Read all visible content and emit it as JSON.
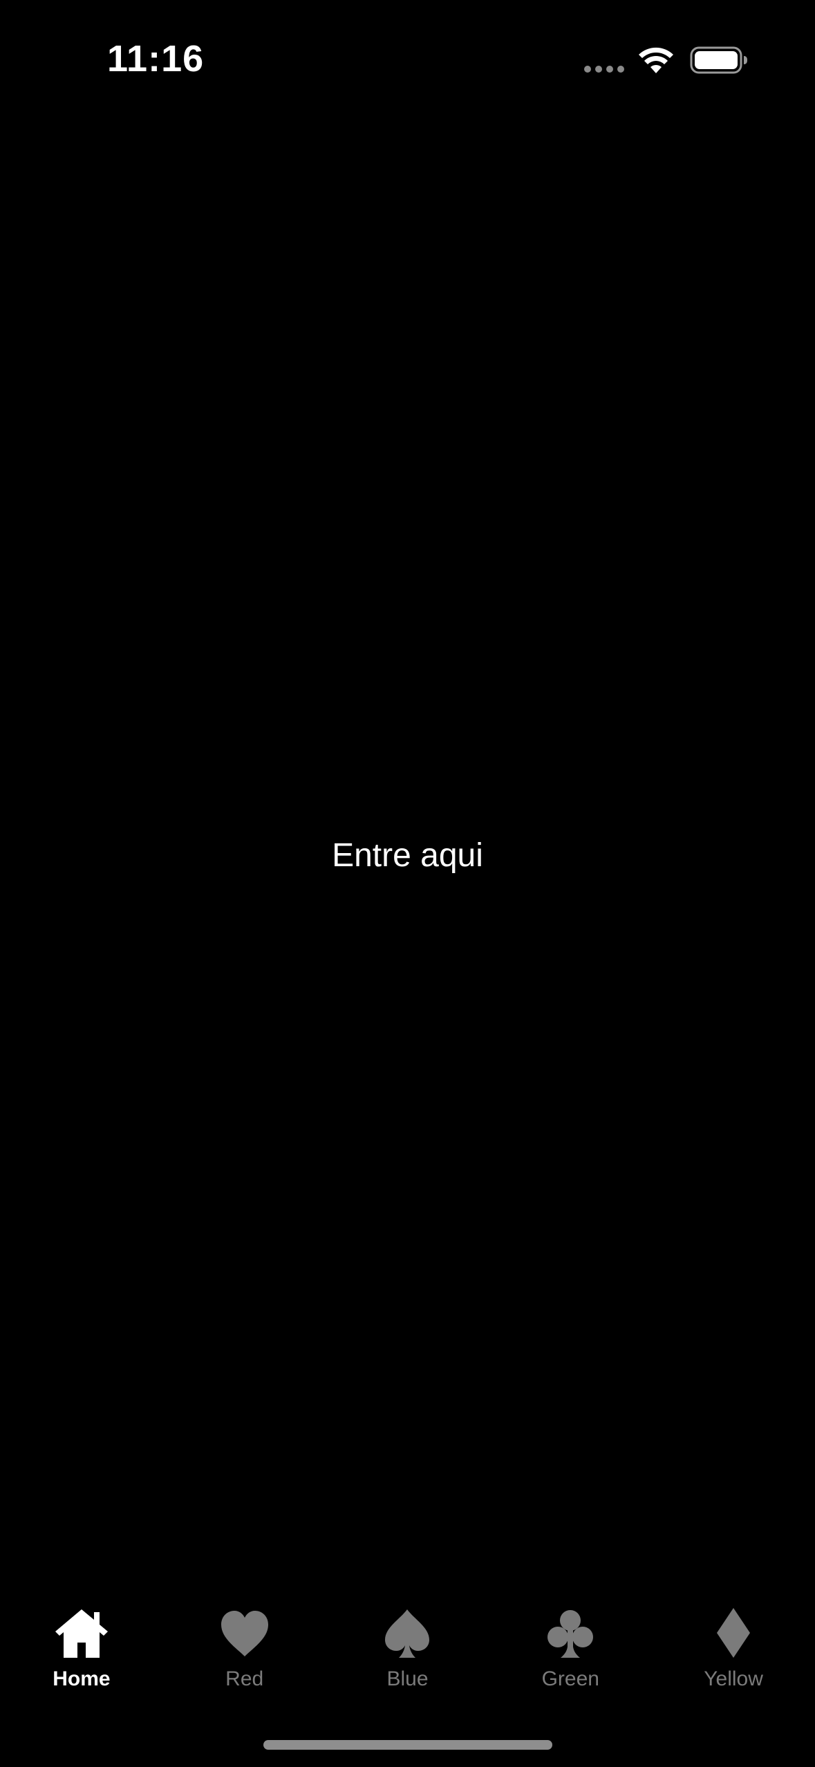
{
  "status_bar": {
    "time": "11:16"
  },
  "main": {
    "center_text": "Entre aqui"
  },
  "tab_bar": {
    "active_color": "#ffffff",
    "inactive_color": "#7b7b7b",
    "tabs": [
      {
        "label": "Home",
        "icon": "house-icon",
        "active": true
      },
      {
        "label": "Red",
        "icon": "heart-icon",
        "active": false
      },
      {
        "label": "Blue",
        "icon": "spade-icon",
        "active": false
      },
      {
        "label": "Green",
        "icon": "club-icon",
        "active": false
      },
      {
        "label": "Yellow",
        "icon": "diamond-icon",
        "active": false
      }
    ]
  }
}
